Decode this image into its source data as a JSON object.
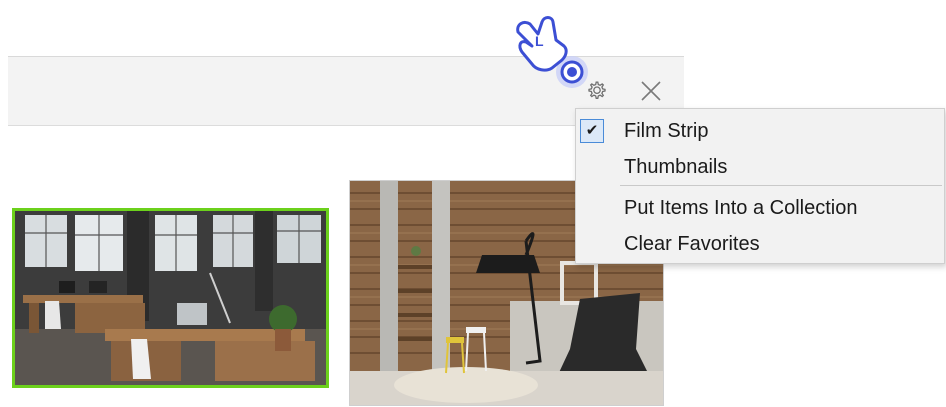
{
  "window": {
    "settings_icon": "gear-icon",
    "close_icon": "close-icon"
  },
  "images": [
    {
      "name": "office-thumbnail",
      "selected": true,
      "border_color": "#6cd11c"
    },
    {
      "name": "living-room-thumbnail",
      "selected": false
    }
  ],
  "menu": {
    "items": [
      {
        "label": "Film Strip",
        "checked": true
      },
      {
        "label": "Thumbnails",
        "checked": false
      },
      {
        "label": "Put Items Into a Collection",
        "checked": false
      },
      {
        "label": "Clear Favorites",
        "checked": false
      }
    ],
    "check_glyph": "✔"
  },
  "cursor": {
    "icon": "hand-pointer-icon",
    "badge": "L",
    "accent": "#3c4fd4"
  }
}
